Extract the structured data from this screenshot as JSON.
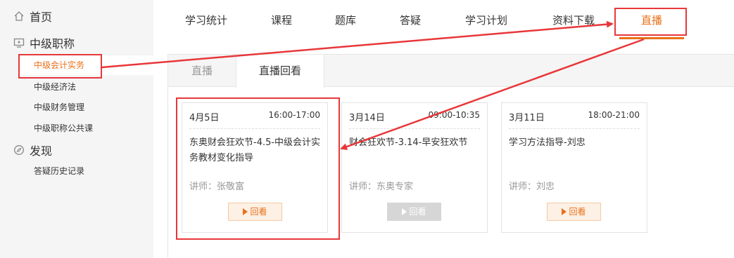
{
  "sidebar": {
    "sections": [
      {
        "label": "首页",
        "icon": "home-icon"
      },
      {
        "label": "中级职称",
        "icon": "monitor-icon"
      },
      {
        "label": "发现",
        "icon": "compass-icon"
      }
    ],
    "courses": [
      "中级会计实务",
      "中级经济法",
      "中级财务管理",
      "中级职称公共课"
    ],
    "discover_items": [
      "答疑历史记录"
    ]
  },
  "topnav": {
    "items": [
      "学习统计",
      "课程",
      "题库",
      "答疑",
      "学习计划",
      "资料下载",
      "直播"
    ],
    "active": "直播"
  },
  "tabs": {
    "items": [
      "直播",
      "直播回看"
    ],
    "active": "直播回看"
  },
  "cards": [
    {
      "date": "4月5日",
      "time": "16:00-17:00",
      "title": "东奥财会狂欢节-4.5-中级会计实务教材变化指导",
      "teacher": "讲师：张敬富",
      "button": "回看",
      "enabled": true
    },
    {
      "date": "3月14日",
      "time": "09:00-10:35",
      "title": "财会狂欢节-3.14-早安狂欢节",
      "teacher": "讲师：东奥专家",
      "button": "回看",
      "enabled": false
    },
    {
      "date": "3月11日",
      "time": "18:00-21:00",
      "title": "学习方法指导-刘忠",
      "teacher": "讲师：刘忠",
      "button": "回看",
      "enabled": true
    }
  ],
  "colors": {
    "accent": "#e8701a",
    "annotation": "#e8373a"
  }
}
